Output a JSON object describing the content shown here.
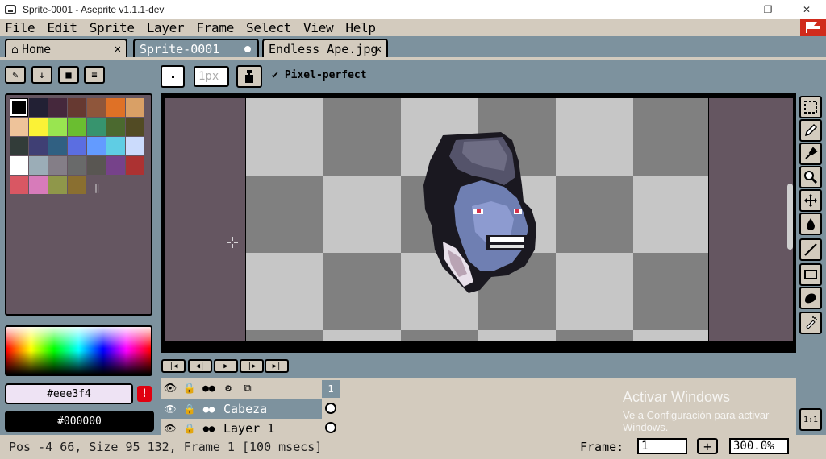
{
  "window": {
    "title": "Sprite-0001 - Aseprite v1.1.1-dev",
    "minimize_glyph": "—",
    "maximize_glyph": "❐",
    "close_glyph": "✕"
  },
  "menu": [
    "File",
    "Edit",
    "Sprite",
    "Layer",
    "Frame",
    "Select",
    "View",
    "Help"
  ],
  "tabs": [
    {
      "label": "Home",
      "close": "✕"
    },
    {
      "label": "Sprite-0001"
    },
    {
      "label": "Endless Ape.jpg",
      "close": "✕"
    }
  ],
  "toolbar": {
    "brush_size_placeholder": "1px",
    "pixel_perfect_label": "Pixel-perfect",
    "pixel_perfect_check": "✔"
  },
  "palette": {
    "colors": [
      "#000000",
      "#222034",
      "#45283c",
      "#663931",
      "#8f563b",
      "#df7126",
      "#d9a066",
      "#eec39a",
      "#fbf236",
      "#99e550",
      "#6abe30",
      "#37946e",
      "#4b692f",
      "#524b24",
      "#323c39",
      "#3f3f74",
      "#306082",
      "#5b6ee1",
      "#639bff",
      "#5fcde4",
      "#cbdbfc",
      "#ffffff",
      "#9badb7",
      "#847e87",
      "#696a6a",
      "#595652",
      "#76428a",
      "#ac3232",
      "#d95763",
      "#d77bba",
      "#8f974a",
      "#8a6f30"
    ],
    "mark": "‖"
  },
  "colors": {
    "fg_hex": "#eee3f4",
    "fg_label": "#eee3f4",
    "bg_hex": "#000000",
    "bg_label": "#000000",
    "warning": "!"
  },
  "timeline": {
    "header_icons": [
      "eye-icon",
      "lock-icon",
      "continuous-icon",
      "gear-icon",
      "onion-skin-icon"
    ],
    "frame_number": "1",
    "layers": [
      {
        "name": "Cabeza",
        "selected": true
      },
      {
        "name": "Layer 1",
        "selected": false
      }
    ]
  },
  "watermark": {
    "title": "Activar Windows",
    "subtitle": "Ve a Configuración para activar",
    "subtitle2": "Windows."
  },
  "status": {
    "text": "Pos -4 66, Size 95 132, Frame 1 [100 msecs]",
    "frame_label": "Frame:",
    "frame_value": "1",
    "plus_label": "+",
    "zoom_value": "300.0%",
    "zoom_reset_label": "1:1"
  }
}
